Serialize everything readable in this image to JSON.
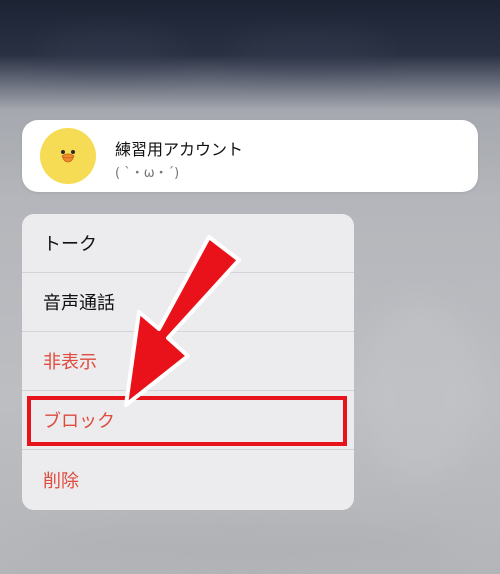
{
  "profile": {
    "name": "練習用アカウント",
    "status": "( ˋ・ω・ˊ)"
  },
  "menu": {
    "items": [
      {
        "label": "トーク",
        "danger": false
      },
      {
        "label": "音声通話",
        "danger": false
      },
      {
        "label": "非表示",
        "danger": true
      },
      {
        "label": "ブロック",
        "danger": true
      },
      {
        "label": "削除",
        "danger": true
      }
    ]
  },
  "colors": {
    "danger_text": "#df4b3c",
    "highlight": "#e7131b",
    "avatar_bg": "#f6dc55"
  }
}
